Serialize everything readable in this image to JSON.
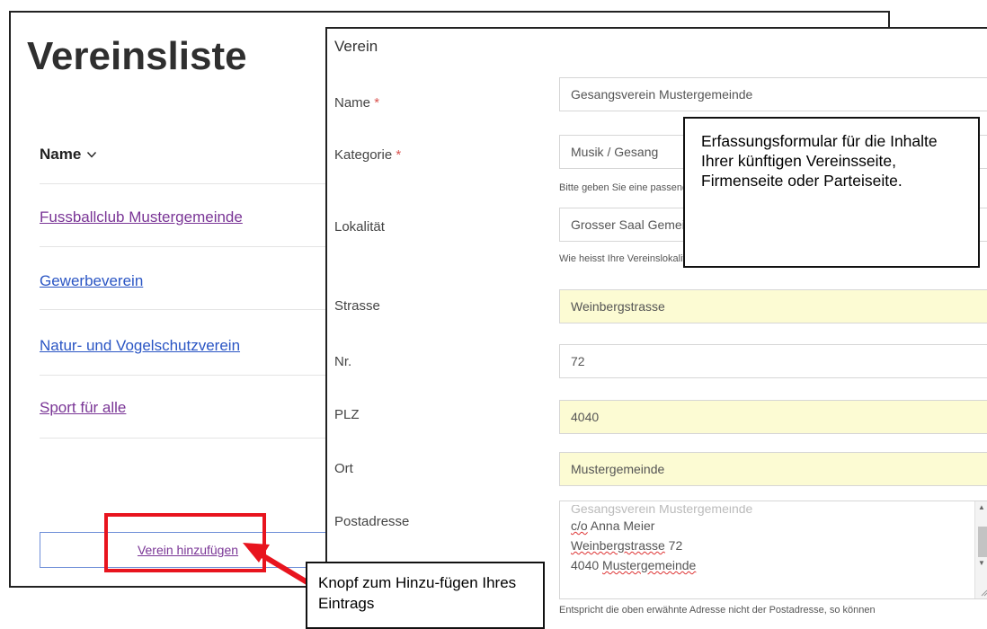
{
  "list_window": {
    "title": "Vereinsliste",
    "column_header": "Name",
    "clubs": [
      {
        "name": "Fussballclub Mustergemeinde",
        "visited": true
      },
      {
        "name": "Gewerbeverein",
        "visited": false
      },
      {
        "name": "Natur- und Vogelschutzverein",
        "visited": false
      },
      {
        "name": "Sport für alle",
        "visited": true
      }
    ],
    "add_button_label": "Verein hinzufügen"
  },
  "form_window": {
    "heading": "Verein",
    "fields": {
      "name": {
        "label": "Name",
        "required_marker": "*",
        "value": "Gesangsverein Mustergemeinde"
      },
      "kategorie": {
        "label": "Kategorie",
        "required_marker": "*",
        "value": "Musik / Gesang",
        "help": "Bitte geben Sie eine passende"
      },
      "lokalitaet": {
        "label": "Lokalität",
        "value": "Grosser Saal Gemeindehaus",
        "help": "Wie heisst Ihre Vereinslokalität?"
      },
      "strasse": {
        "label": "Strasse",
        "value": "Weinbergstrasse"
      },
      "nr": {
        "label": "Nr.",
        "value": "72"
      },
      "plz": {
        "label": "PLZ",
        "value": "4040"
      },
      "ort": {
        "label": "Ort",
        "value": "Mustergemeinde"
      },
      "postadresse": {
        "label": "Postadresse",
        "lines": [
          "Gesangsverein Mustergemeinde",
          "c/o Anna Meier",
          "Weinbergstrasse 72",
          "4040 Mustergemeinde"
        ],
        "help": "Entspricht die oben erwähnte Adresse nicht der Postadresse, so können"
      }
    }
  },
  "callouts": {
    "form_note": "Erfassungsformular für die Inhalte Ihrer künftigen Vereinsseite, Firmenseite oder Parteiseite.",
    "button_note": "Knopf zum Hinzu-fügen Ihres Eintrags"
  },
  "colors": {
    "highlight_field": "#fcfbd3",
    "annotation_red": "#e8141e",
    "link_visited": "#7a3596",
    "link": "#2a55c4"
  }
}
